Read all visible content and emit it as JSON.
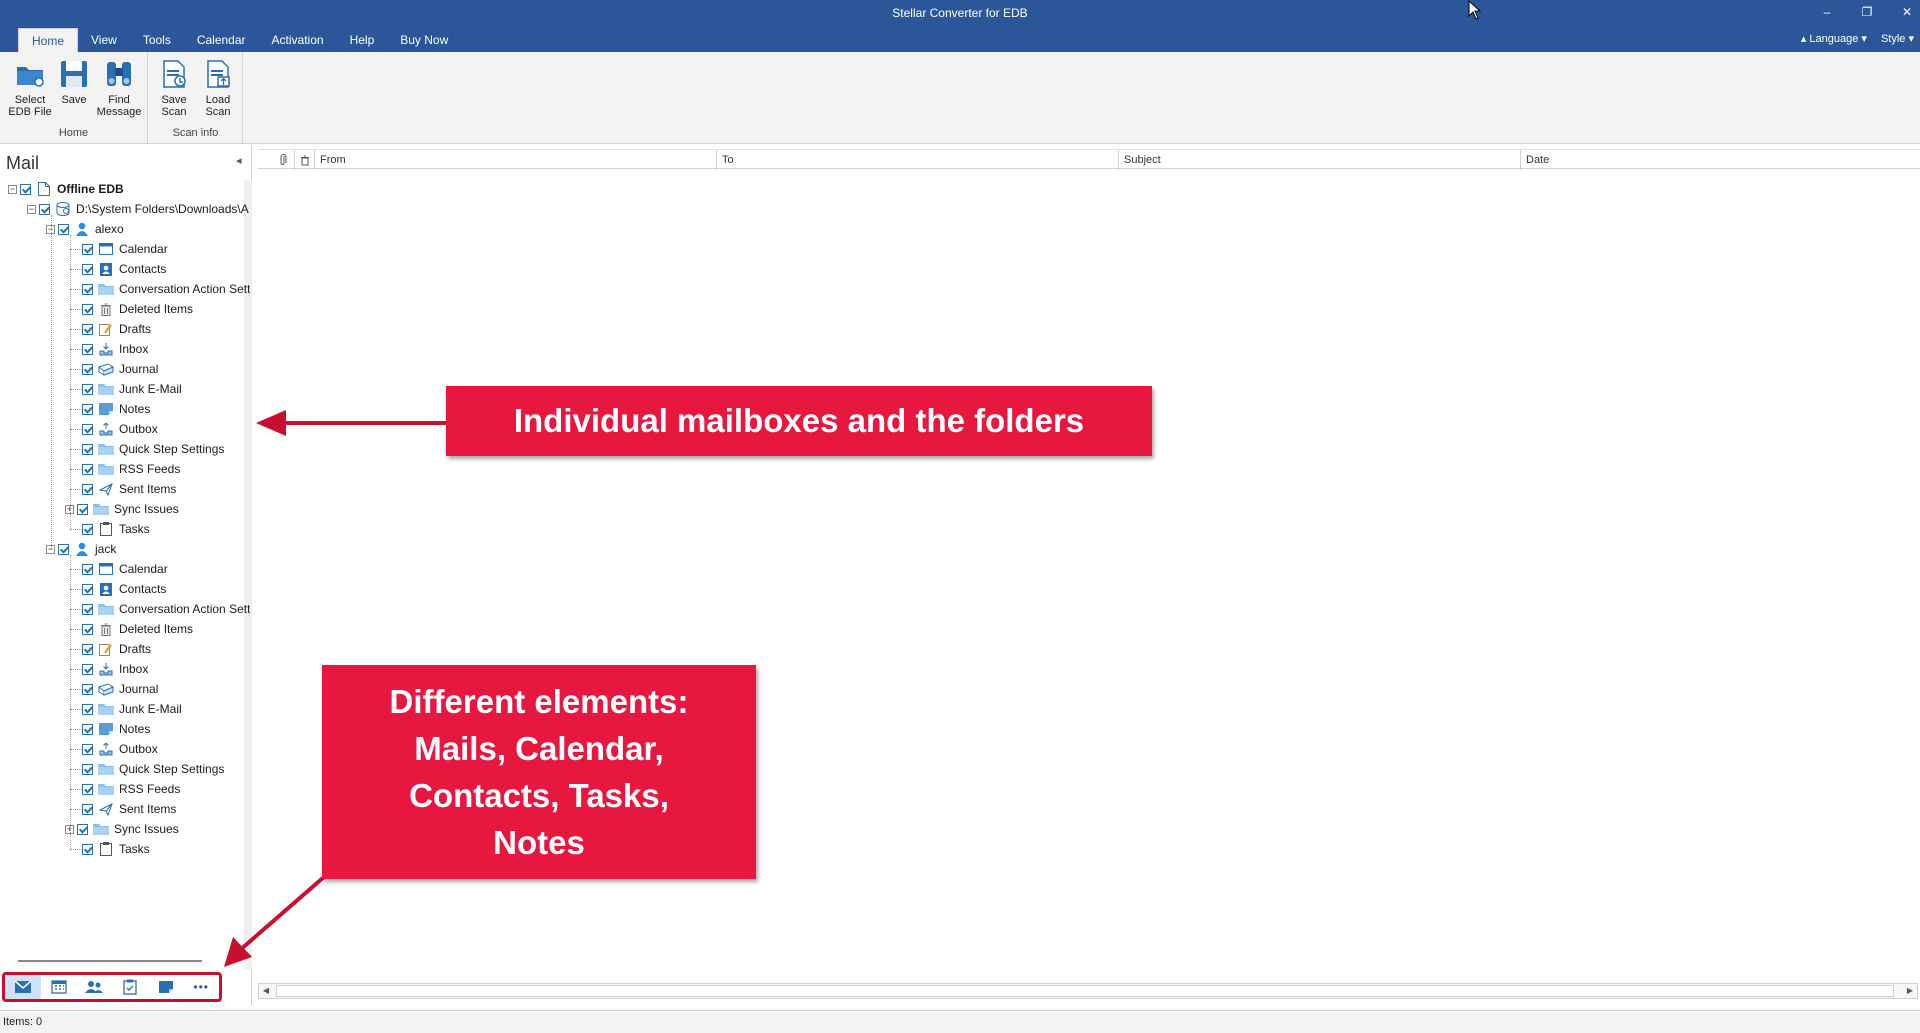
{
  "window": {
    "title": "Stellar Converter for EDB",
    "minimize": "–",
    "restore": "❐",
    "close": "✕"
  },
  "menu_tabs": [
    "Home",
    "View",
    "Tools",
    "Calendar",
    "Activation",
    "Help",
    "Buy Now"
  ],
  "right_tools": {
    "language": "Language",
    "style": "Style"
  },
  "ribbon": {
    "home_group": {
      "label": "Home",
      "buttons": [
        {
          "label": "Select\nEDB File",
          "icon": "folder-icon"
        },
        {
          "label": "Save",
          "icon": "save-icon"
        },
        {
          "label": "Find\nMessage",
          "icon": "binoculars-icon"
        }
      ]
    },
    "scan_group": {
      "label": "Scan info",
      "buttons": [
        {
          "label": "Save\nScan",
          "icon": "save-scan-icon"
        },
        {
          "label": "Load\nScan",
          "icon": "load-scan-icon"
        }
      ]
    }
  },
  "nav": {
    "header": "Mail",
    "collapse": "◂",
    "root": "Offline EDB",
    "path": "D:\\System Folders\\Downloads\\A",
    "mailboxes": [
      {
        "name": "alexo",
        "folders": [
          "Calendar",
          "Contacts",
          "Conversation Action Sett",
          "Deleted Items",
          "Drafts",
          "Inbox",
          "Journal",
          "Junk E-Mail",
          "Notes",
          "Outbox",
          "Quick Step Settings",
          "RSS Feeds",
          "Sent Items",
          "Sync Issues",
          "Tasks"
        ]
      },
      {
        "name": "jack",
        "folders": [
          "Calendar",
          "Contacts",
          "Conversation Action Sett",
          "Deleted Items",
          "Drafts",
          "Inbox",
          "Journal",
          "Junk E-Mail",
          "Notes",
          "Outbox",
          "Quick Step Settings",
          "RSS Feeds",
          "Sent Items",
          "Sync Issues",
          "Tasks"
        ]
      }
    ],
    "bottom_buttons": [
      "mail-icon",
      "calendar-icon",
      "contacts-icon",
      "tasks-icon",
      "notes-icon",
      "more-icon"
    ],
    "more_label": "•••"
  },
  "grid": {
    "columns": [
      "From",
      "To",
      "Subject",
      "Date"
    ]
  },
  "status": {
    "items": "Items: 0"
  },
  "callouts": {
    "mailboxes": "Individual mailboxes and the folders",
    "elements": "Different elements:\nMails, Calendar,\nContacts, Tasks,\nNotes"
  },
  "colors": {
    "title_bar": "#2b579a",
    "ribbon": "#f3f3f3",
    "callout": "#e8173f",
    "arrow": "#c8102e",
    "accent": "#2b6fb3"
  }
}
